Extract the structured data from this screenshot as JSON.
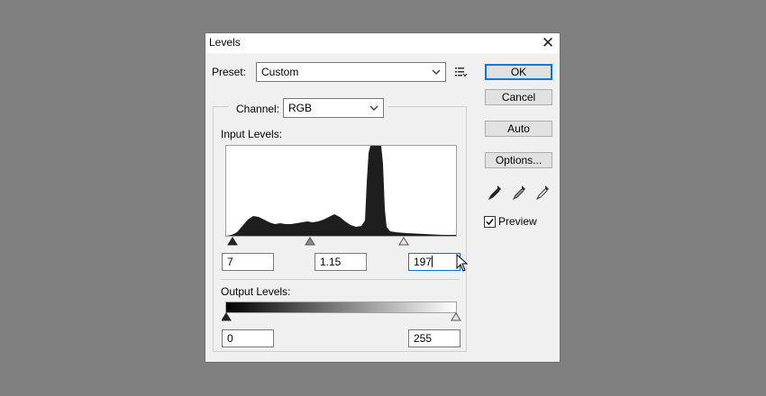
{
  "dialog": {
    "title": "Levels",
    "close_symbol": "✕"
  },
  "preset": {
    "label": "Preset:",
    "value": "Custom",
    "menu_icon": "preset-options-icon"
  },
  "channel": {
    "label": "Channel:",
    "value": "RGB"
  },
  "input_levels": {
    "label": "Input Levels:",
    "black": "7",
    "midtone": "1.15",
    "white": "197"
  },
  "output_levels": {
    "label": "Output Levels:",
    "black": "0",
    "white": "255"
  },
  "buttons": {
    "ok": "OK",
    "cancel": "Cancel",
    "auto": "Auto",
    "options": "Options..."
  },
  "eyedroppers": [
    "black-point-eyedropper-icon",
    "gray-point-eyedropper-icon",
    "white-point-eyedropper-icon"
  ],
  "preview": {
    "label": "Preview",
    "checked": true
  },
  "colors": {
    "accent": "#0078d7",
    "histogram_fill": "#1e1e1e",
    "backdrop": "#808080"
  }
}
